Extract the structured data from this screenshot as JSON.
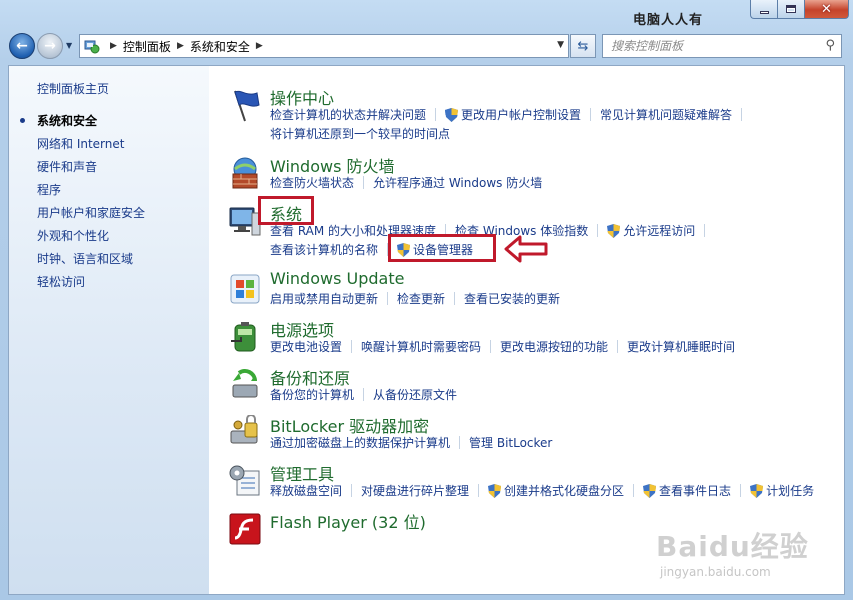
{
  "window": {
    "title_overlay": "电脑人人有",
    "controls": {
      "minimize": "minimize",
      "maximize": "maximize",
      "close": "close"
    }
  },
  "nav": {
    "breadcrumb": [
      "控制面板",
      "系统和安全"
    ],
    "search_placeholder": "搜索控制面板"
  },
  "sidebar": {
    "home": "控制面板主页",
    "items": [
      {
        "label": "系统和安全",
        "active": true
      },
      {
        "label": "网络和 Internet",
        "active": false
      },
      {
        "label": "硬件和声音",
        "active": false
      },
      {
        "label": "程序",
        "active": false
      },
      {
        "label": "用户帐户和家庭安全",
        "active": false
      },
      {
        "label": "外观和个性化",
        "active": false
      },
      {
        "label": "时钟、语言和区域",
        "active": false
      },
      {
        "label": "轻松访问",
        "active": false
      }
    ]
  },
  "categories": {
    "action_center": {
      "title": "操作中心",
      "row1": [
        "检查计算机的状态并解决问题",
        "更改用户帐户控制设置",
        "常见计算机问题疑难解答"
      ],
      "row2": [
        "将计算机还原到一个较早的时间点"
      ]
    },
    "firewall": {
      "title": "Windows 防火墙",
      "row1": [
        "检查防火墙状态",
        "允许程序通过 Windows 防火墙"
      ]
    },
    "system": {
      "title": "系统",
      "row1": [
        "查看 RAM 的大小和处理器速度",
        "检查 Windows 体验指数",
        "允许远程访问"
      ],
      "row2": [
        "查看该计算机的名称",
        "设备管理器"
      ]
    },
    "update": {
      "title": "Windows Update",
      "row1": [
        "启用或禁用自动更新",
        "检查更新",
        "查看已安装的更新"
      ]
    },
    "power": {
      "title": "电源选项",
      "row1": [
        "更改电池设置",
        "唤醒计算机时需要密码",
        "更改电源按钮的功能",
        "更改计算机睡眠时间"
      ]
    },
    "backup": {
      "title": "备份和还原",
      "row1": [
        "备份您的计算机",
        "从备份还原文件"
      ]
    },
    "bitlocker": {
      "title": "BitLocker 驱动器加密",
      "row1": [
        "通过加密磁盘上的数据保护计算机",
        "管理 BitLocker"
      ]
    },
    "admin": {
      "title": "管理工具",
      "row1": [
        "释放磁盘空间",
        "对硬盘进行碎片整理",
        "创建并格式化硬盘分区",
        "查看事件日志",
        "计划任务"
      ]
    },
    "flash": {
      "title": "Flash Player (32 位)"
    }
  },
  "watermark": {
    "brand": "Baidu经验",
    "url": "jingyan.baidu.com"
  },
  "colors": {
    "link": "#1a3b8a",
    "category_title": "#1f6b2e",
    "highlight": "#c0192b"
  }
}
